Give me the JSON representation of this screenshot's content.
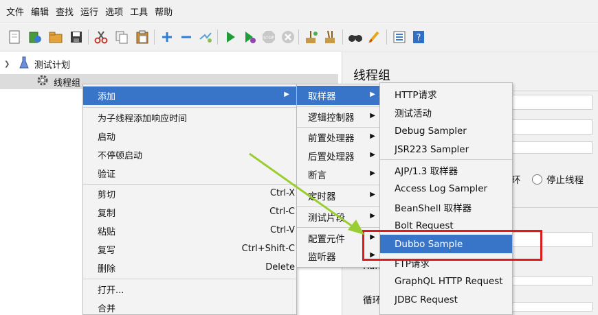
{
  "menubar": {
    "items": [
      "文件",
      "编辑",
      "查找",
      "运行",
      "选项",
      "工具",
      "帮助"
    ]
  },
  "toolbar": {
    "icons": [
      "new-icon",
      "templates-icon",
      "open-icon",
      "save-icon",
      "cut-icon",
      "copy-icon",
      "paste-icon",
      "expand-icon",
      "collapse-icon",
      "toggle-icon",
      "start-icon",
      "start-no-pause-icon",
      "stop-icon",
      "shutdown-icon",
      "clear-icon",
      "clear-all-icon",
      "search-icon",
      "reset-search-icon",
      "function-helper-icon",
      "help-icon"
    ]
  },
  "tree": {
    "test_plan": "测试计划",
    "thread_group": "线程组"
  },
  "right_panel": {
    "title": "线程组",
    "partial_loop": "环",
    "stop_thread": "停止线程",
    "ramp_partial": "Ran",
    "loop_partial": "循环"
  },
  "context_menu": {
    "items": [
      {
        "label": "添加",
        "submenu": true
      },
      {
        "label": "为子线程添加响应时间"
      },
      {
        "label": "启动"
      },
      {
        "label": "不停顿启动"
      },
      {
        "label": "验证"
      },
      {
        "label": "剪切",
        "shortcut": "Ctrl-X"
      },
      {
        "label": "复制",
        "shortcut": "Ctrl-C"
      },
      {
        "label": "粘贴",
        "shortcut": "Ctrl-V"
      },
      {
        "label": "复写",
        "shortcut": "Ctrl+Shift-C"
      },
      {
        "label": "删除",
        "shortcut": "Delete"
      },
      {
        "label": "打开..."
      },
      {
        "label": "合并"
      }
    ]
  },
  "add_submenu": {
    "items": [
      "取样器",
      "逻辑控制器",
      "前置处理器",
      "后置处理器",
      "断言",
      "定时器",
      "测试片段",
      "配置元件",
      "监听器"
    ]
  },
  "sampler_submenu": {
    "items": [
      "HTTP请求",
      "测试活动",
      "Debug Sampler",
      "JSR223 Sampler",
      "AJP/1.3 取样器",
      "Access Log Sampler",
      "BeanShell 取样器",
      "Bolt Request",
      "Dubbo Sample",
      "FTP请求",
      "GraphQL HTTP Request",
      "JDBC Request"
    ],
    "selected": "Dubbo Sample"
  },
  "colors": {
    "selection": "#3875c9",
    "highlight_box": "#e0191c",
    "pointer_arrow": "#9acd32"
  }
}
